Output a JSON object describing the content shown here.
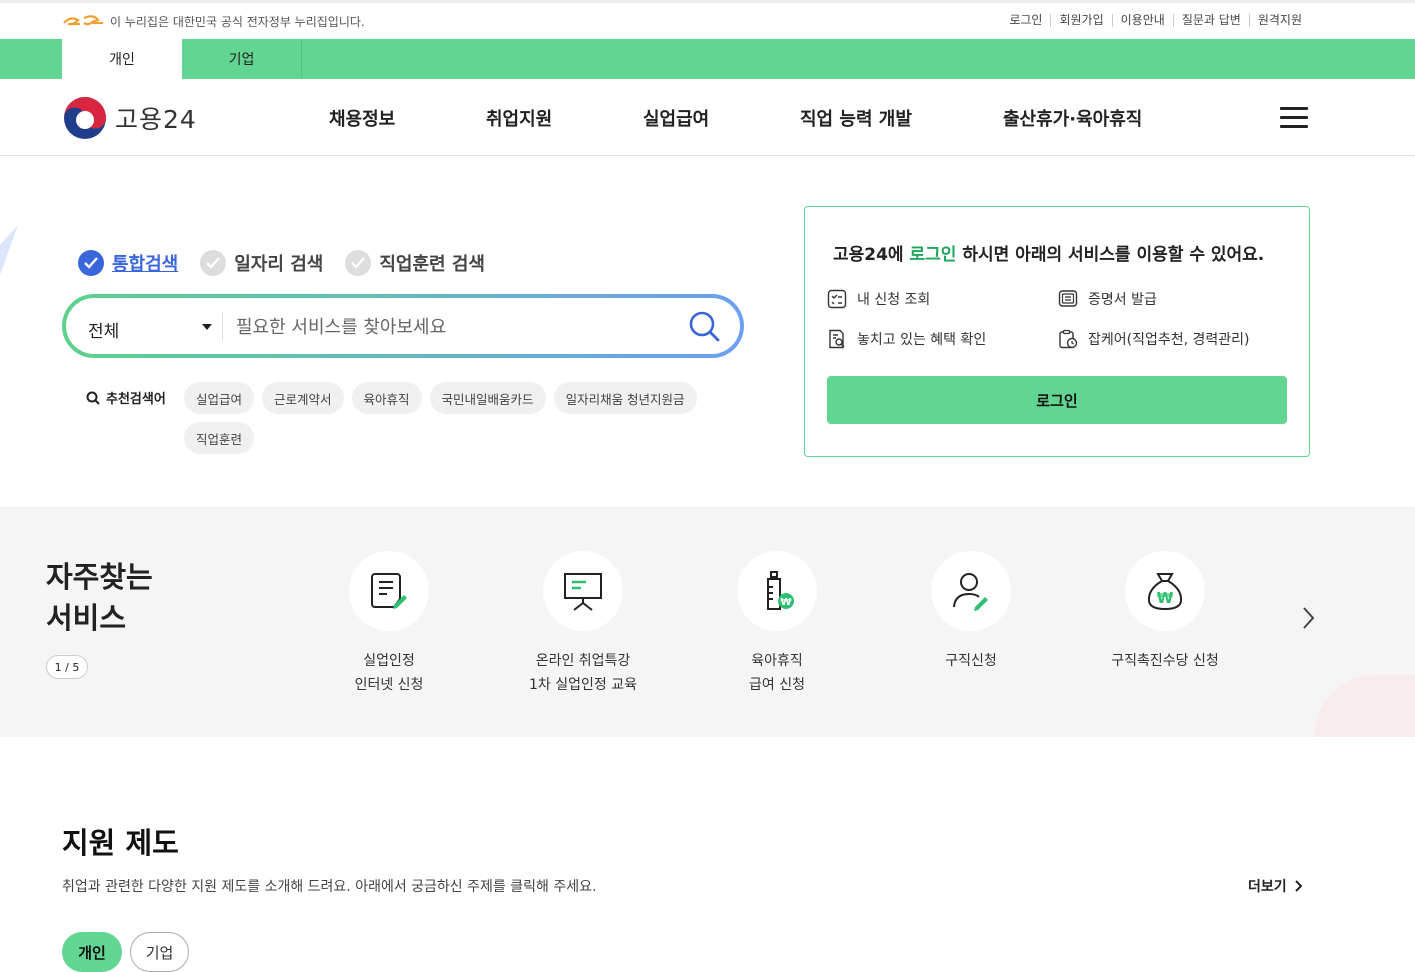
{
  "util": {
    "gov_notice": "이 누리집은 대한민국 공식 전자정부 누리집입니다.",
    "links": [
      "로그인",
      "회원가입",
      "이용안내",
      "질문과 답변",
      "원격지원"
    ]
  },
  "tabs": [
    "개인",
    "기업"
  ],
  "header": {
    "logo_text": "고용24",
    "nav": [
      "채용정보",
      "취업지원",
      "실업급여",
      "직업 능력 개발",
      "출산휴가·육아휴직"
    ]
  },
  "search": {
    "tabs": [
      "통합검색",
      "일자리 검색",
      "직업훈련 검색"
    ],
    "select_value": "전체",
    "placeholder": "필요한 서비스를 찾아보세요",
    "reco_label": "추천검색어",
    "keywords": [
      "실업급여",
      "근로계약서",
      "육아휴직",
      "국민내일배움카드",
      "일자리채움 청년지원금",
      "직업훈련"
    ]
  },
  "login_box": {
    "title_pre": "고용24에 ",
    "title_hl": "로그인",
    "title_post": " 하시면 아래의 서비스를 이용할 수 있어요.",
    "items": [
      "내 신청 조회",
      "증명서 발급",
      "놓치고 있는 혜택 확인",
      "잡케어(직업추천, 경력관리)"
    ],
    "button": "로그인"
  },
  "frequent": {
    "title_line1": "자주찾는",
    "title_line2": "서비스",
    "pager": "1 / 5",
    "services": [
      {
        "line1": "실업인정",
        "line2": "인터넷 신청",
        "icon": "document-pen-icon"
      },
      {
        "line1": "온라인 취업특강",
        "line2": "1차 실업인정 교육",
        "icon": "presentation-board-icon"
      },
      {
        "line1": "육아휴직",
        "line2": "급여 신청",
        "icon": "baby-bottle-won-icon"
      },
      {
        "line1": "구직신청",
        "line2": "",
        "icon": "person-pen-icon"
      },
      {
        "line1": "구직촉진수당 신청",
        "line2": "",
        "icon": "money-bag-won-icon"
      }
    ]
  },
  "support": {
    "title": "지원 제도",
    "desc": "취업과 관련한 다양한 지원 제도를 소개해 드려요. 아래에서 궁금하신 주제를 클릭해 주세요.",
    "more": "더보기",
    "pills": [
      "개인",
      "기업"
    ]
  },
  "colors": {
    "brand_green": "#61d591",
    "accent_blue": "#3a66db",
    "highlight_green": "#1ea65c"
  }
}
